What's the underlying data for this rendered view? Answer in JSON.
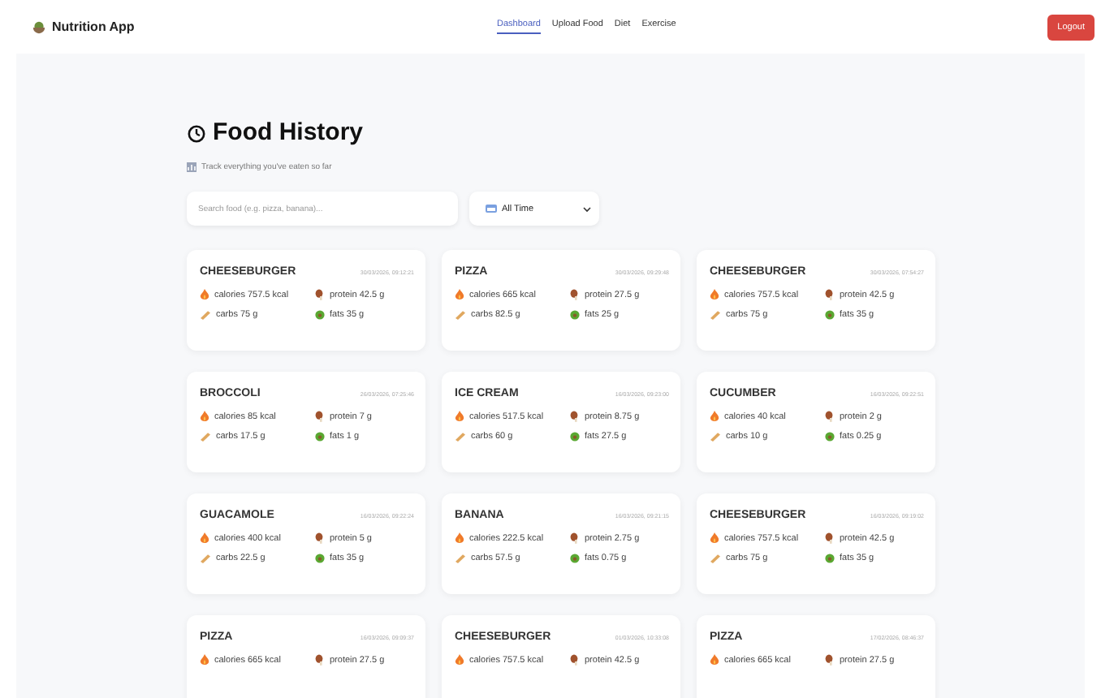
{
  "app": {
    "title": "Nutrition App"
  },
  "nav": [
    {
      "label": "Dashboard",
      "selected": true
    },
    {
      "label": "Upload Food",
      "selected": false
    },
    {
      "label": "Diet",
      "selected": false
    },
    {
      "label": "Exercise",
      "selected": false
    }
  ],
  "logout": "Logout",
  "page": {
    "title": "Food History",
    "subtitle": "Track everything you've eaten so far"
  },
  "search": {
    "placeholder": "Search food (e.g. pizza, banana)..."
  },
  "filter": {
    "value": "All Time"
  },
  "entries": [
    {
      "name": "CHEESEBURGER",
      "date": "30/03/2026, 09:12:21",
      "stats": [
        {
          "kind": "calories",
          "text": "calories 757.5 kcal"
        },
        {
          "kind": "protein",
          "text": "protein 42.5 g"
        },
        {
          "kind": "carbs",
          "text": "carbs 75 g"
        },
        {
          "kind": "fats",
          "text": "fats 35 g"
        }
      ]
    },
    {
      "name": "PIZZA",
      "date": "30/03/2026, 09:29:48",
      "stats": [
        {
          "kind": "calories",
          "text": "calories 665 kcal"
        },
        {
          "kind": "protein",
          "text": "protein 27.5 g"
        },
        {
          "kind": "carbs",
          "text": "carbs 82.5 g"
        },
        {
          "kind": "fats",
          "text": "fats 25 g"
        }
      ]
    },
    {
      "name": "CHEESEBURGER",
      "date": "30/03/2026, 07:54:27",
      "stats": [
        {
          "kind": "calories",
          "text": "calories 757.5 kcal"
        },
        {
          "kind": "protein",
          "text": "protein 42.5 g"
        },
        {
          "kind": "carbs",
          "text": "carbs 75 g"
        },
        {
          "kind": "fats",
          "text": "fats 35 g"
        }
      ]
    },
    {
      "name": "BROCCOLI",
      "date": "26/03/2026, 07:25:46",
      "stats": [
        {
          "kind": "calories",
          "text": "calories 85 kcal"
        },
        {
          "kind": "protein",
          "text": "protein 7 g"
        },
        {
          "kind": "carbs",
          "text": "carbs 17.5 g"
        },
        {
          "kind": "fats",
          "text": "fats 1 g"
        }
      ]
    },
    {
      "name": "ICE CREAM",
      "date": "16/03/2026, 09:23:00",
      "stats": [
        {
          "kind": "calories",
          "text": "calories 517.5 kcal"
        },
        {
          "kind": "protein",
          "text": "protein 8.75 g"
        },
        {
          "kind": "carbs",
          "text": "carbs 60 g"
        },
        {
          "kind": "fats",
          "text": "fats 27.5 g"
        }
      ]
    },
    {
      "name": "CUCUMBER",
      "date": "16/03/2026, 09:22:51",
      "stats": [
        {
          "kind": "calories",
          "text": "calories 40 kcal"
        },
        {
          "kind": "protein",
          "text": "protein 2 g"
        },
        {
          "kind": "carbs",
          "text": "carbs 10 g"
        },
        {
          "kind": "fats",
          "text": "fats 0.25 g"
        }
      ]
    },
    {
      "name": "GUACAMOLE",
      "date": "16/03/2026, 09:22:24",
      "stats": [
        {
          "kind": "calories",
          "text": "calories 400 kcal"
        },
        {
          "kind": "protein",
          "text": "protein 5 g"
        },
        {
          "kind": "carbs",
          "text": "carbs 22.5 g"
        },
        {
          "kind": "fats",
          "text": "fats 35 g"
        }
      ]
    },
    {
      "name": "BANANA",
      "date": "16/03/2026, 09:21:15",
      "stats": [
        {
          "kind": "calories",
          "text": "calories 222.5 kcal"
        },
        {
          "kind": "protein",
          "text": "protein 2.75 g"
        },
        {
          "kind": "carbs",
          "text": "carbs 57.5 g"
        },
        {
          "kind": "fats",
          "text": "fats 0.75 g"
        }
      ]
    },
    {
      "name": "CHEESEBURGER",
      "date": "16/03/2026, 09:19:02",
      "stats": [
        {
          "kind": "calories",
          "text": "calories 757.5 kcal"
        },
        {
          "kind": "protein",
          "text": "protein 42.5 g"
        },
        {
          "kind": "carbs",
          "text": "carbs 75 g"
        },
        {
          "kind": "fats",
          "text": "fats 35 g"
        }
      ]
    },
    {
      "name": "PIZZA",
      "date": "16/03/2026, 09:09:37",
      "stats": [
        {
          "kind": "calories",
          "text": "calories 665 kcal"
        },
        {
          "kind": "protein",
          "text": "protein 27.5 g"
        }
      ]
    },
    {
      "name": "CHEESEBURGER",
      "date": "01/03/2026, 10:33:08",
      "stats": [
        {
          "kind": "calories",
          "text": "calories 757.5 kcal"
        },
        {
          "kind": "protein",
          "text": "protein 42.5 g"
        }
      ]
    },
    {
      "name": "PIZZA",
      "date": "17/02/2026, 08:46:37",
      "stats": [
        {
          "kind": "calories",
          "text": "calories 665 kcal"
        },
        {
          "kind": "protein",
          "text": "protein 27.5 g"
        }
      ]
    }
  ]
}
